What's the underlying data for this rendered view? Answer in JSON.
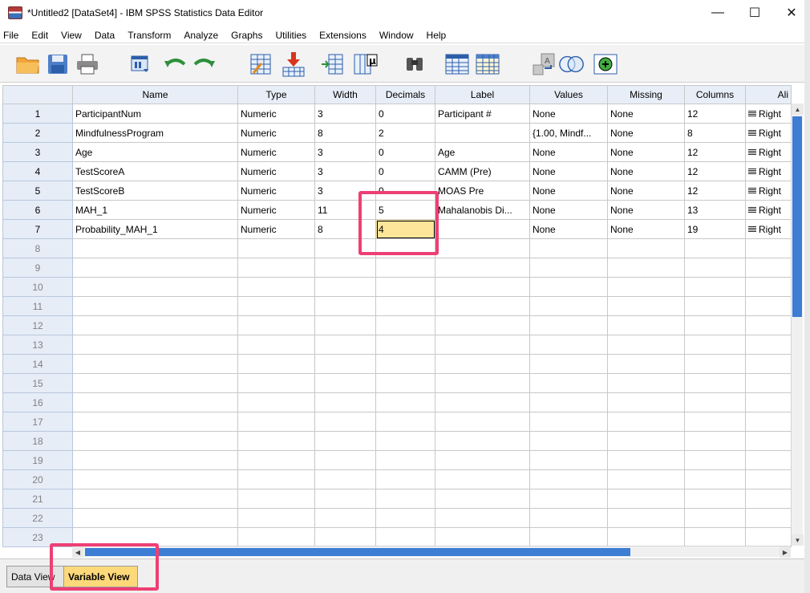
{
  "window": {
    "title": "*Untitled2 [DataSet4] - IBM SPSS Statistics Data Editor",
    "minimize": "—",
    "maximize": "☐",
    "close": "✕"
  },
  "menu": [
    "File",
    "Edit",
    "View",
    "Data",
    "Transform",
    "Analyze",
    "Graphs",
    "Utilities",
    "Extensions",
    "Window",
    "Help"
  ],
  "toolbar": {
    "icons": [
      "open-folder-icon",
      "save-icon",
      "print-icon",
      "dialog-recall-icon",
      "undo-icon",
      "redo-icon",
      "goto-case-icon",
      "goto-variable-icon",
      "variables-icon",
      "run-descriptive-icon",
      "find-icon",
      "insert-cases-icon",
      "insert-variable-icon",
      "split-file-icon",
      "weight-cases-icon",
      "value-labels-icon"
    ]
  },
  "grid": {
    "columns": [
      "Name",
      "Type",
      "Width",
      "Decimals",
      "Label",
      "Values",
      "Missing",
      "Columns",
      "Ali"
    ],
    "rows": [
      {
        "num": "1",
        "name": "ParticipantNum",
        "type": "Numeric",
        "width": "3",
        "decimals": "0",
        "label": "Participant #",
        "values": "None",
        "missing": "None",
        "columns": "12",
        "align": "Right"
      },
      {
        "num": "2",
        "name": "MindfulnessProgram",
        "type": "Numeric",
        "width": "8",
        "decimals": "2",
        "label": "",
        "values": "{1.00, Mindf...",
        "missing": "None",
        "columns": "8",
        "align": "Right"
      },
      {
        "num": "3",
        "name": "Age",
        "type": "Numeric",
        "width": "3",
        "decimals": "0",
        "label": "Age",
        "values": "None",
        "missing": "None",
        "columns": "12",
        "align": "Right"
      },
      {
        "num": "4",
        "name": "TestScoreA",
        "type": "Numeric",
        "width": "3",
        "decimals": "0",
        "label": "CAMM (Pre)",
        "values": "None",
        "missing": "None",
        "columns": "12",
        "align": "Right"
      },
      {
        "num": "5",
        "name": "TestScoreB",
        "type": "Numeric",
        "width": "3",
        "decimals": "0",
        "label": "MOAS Pre",
        "values": "None",
        "missing": "None",
        "columns": "12",
        "align": "Right"
      },
      {
        "num": "6",
        "name": "MAH_1",
        "type": "Numeric",
        "width": "11",
        "decimals": "5",
        "label": "Mahalanobis Di...",
        "values": "None",
        "missing": "None",
        "columns": "13",
        "align": "Right"
      },
      {
        "num": "7",
        "name": "Probability_MAH_1",
        "type": "Numeric",
        "width": "8",
        "decimals": "4",
        "label": "",
        "values": "None",
        "missing": "None",
        "columns": "19",
        "align": "Right"
      }
    ],
    "blank_rows": [
      "8",
      "9",
      "10",
      "11",
      "12",
      "13",
      "14",
      "15",
      "16",
      "17",
      "18",
      "19",
      "20",
      "21",
      "22",
      "23"
    ],
    "selected_cell": {
      "row": "7",
      "column": "Decimals"
    }
  },
  "tabs": {
    "data_view": "Data View",
    "variable_view": "Variable View",
    "active": "Variable View"
  },
  "colors": {
    "highlight": "#ee3f74",
    "selected_cell": "#fde59a",
    "active_tab": "#fdd97a",
    "scroll_thumb": "#3d7dd4"
  }
}
